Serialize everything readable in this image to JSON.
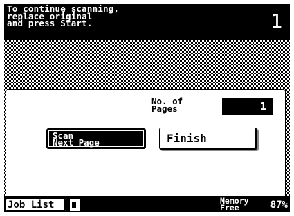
{
  "message": {
    "text": "To continue scanning,\nreplace original\nand press Start.",
    "copy_count": "1"
  },
  "dialog": {
    "pages_label": "No. of\nPages",
    "pages_value": "1",
    "scan_next_label": "Scan\nNext Page",
    "finish_label": "Finish"
  },
  "status_bar": {
    "job_list_label": "Job List",
    "document_icon": "document-icon",
    "memory_label": "Memory\nFree",
    "memory_value": "87%"
  },
  "colors": {
    "foreground": "#000000",
    "background": "#ffffff"
  }
}
